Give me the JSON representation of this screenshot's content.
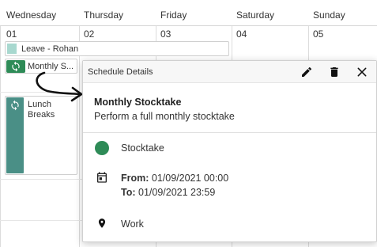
{
  "calendar": {
    "days": [
      {
        "name": "Wednesday",
        "date": "01"
      },
      {
        "name": "Thursday",
        "date": "02"
      },
      {
        "name": "Friday",
        "date": "03"
      },
      {
        "name": "Saturday",
        "date": "04"
      },
      {
        "name": "Sunday",
        "date": "05"
      }
    ],
    "events": {
      "leave": "Leave - Rohan",
      "monthly": "Monthly S...",
      "lunch": "Lunch Breaks"
    }
  },
  "popup": {
    "title": "Schedule Details",
    "subject": "Monthly Stocktake",
    "description": "Perform a full monthly stocktake",
    "category": "Stocktake",
    "from_label": "From:",
    "from_value": " 01/09/2021 00:00",
    "to_label": "To:",
    "to_value": " 01/09/2021 23:59",
    "location": "Work",
    "actions": {
      "edit": "edit-icon",
      "delete": "delete-icon",
      "close": "close-icon"
    }
  },
  "colors": {
    "category_green": "#2e8b57",
    "leave_swatch": "#a8d8cf",
    "lunch_bar": "#4a8f86"
  }
}
